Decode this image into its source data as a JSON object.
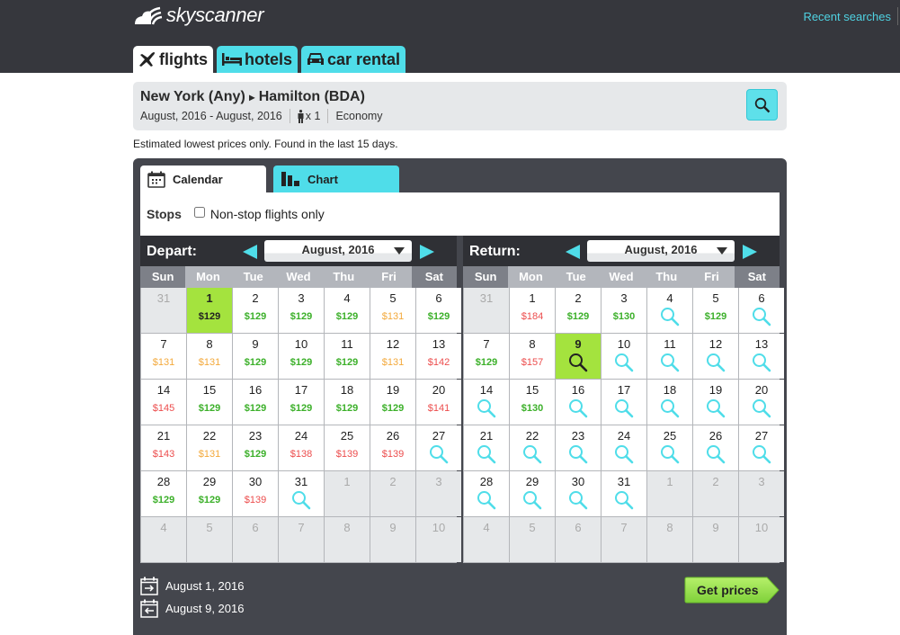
{
  "header": {
    "brand": "skyscanner",
    "recent_searches": "Recent searches"
  },
  "nav_tabs": [
    {
      "label": "flights",
      "icon": "plane-icon",
      "active": true
    },
    {
      "label": "hotels",
      "icon": "bed-icon",
      "active": false
    },
    {
      "label": "car rental",
      "icon": "car-icon",
      "active": false
    }
  ],
  "search": {
    "origin": "New York (Any)",
    "arrow": "▸",
    "destination": "Hamilton (BDA)",
    "dates": "August, 2016 - August, 2016",
    "passengers": "x 1",
    "cabin": "Economy"
  },
  "note": "Estimated lowest prices only. Found in the last 15 days.",
  "panel_tabs": [
    {
      "label": "Calendar",
      "icon": "calendar-icon",
      "active": true
    },
    {
      "label": "Chart",
      "icon": "bar-chart-icon",
      "active": false
    }
  ],
  "stops": {
    "label": "Stops",
    "option": "Non-stop flights only",
    "checked": false
  },
  "weekdays": [
    "Sun",
    "Mon",
    "Tue",
    "Wed",
    "Thu",
    "Fri",
    "Sat"
  ],
  "depart": {
    "title": "Depart:",
    "month": "August, 2016",
    "cells": [
      {
        "d": "31",
        "other": true
      },
      {
        "d": "1",
        "p": "$129",
        "c": "g",
        "sel": true
      },
      {
        "d": "2",
        "p": "$129",
        "c": "g"
      },
      {
        "d": "3",
        "p": "$129",
        "c": "g"
      },
      {
        "d": "4",
        "p": "$129",
        "c": "g"
      },
      {
        "d": "5",
        "p": "$131",
        "c": "o"
      },
      {
        "d": "6",
        "p": "$129",
        "c": "g"
      },
      {
        "d": "7",
        "p": "$131",
        "c": "o"
      },
      {
        "d": "8",
        "p": "$131",
        "c": "o"
      },
      {
        "d": "9",
        "p": "$129",
        "c": "g"
      },
      {
        "d": "10",
        "p": "$129",
        "c": "g"
      },
      {
        "d": "11",
        "p": "$129",
        "c": "g"
      },
      {
        "d": "12",
        "p": "$131",
        "c": "o"
      },
      {
        "d": "13",
        "p": "$142",
        "c": "r"
      },
      {
        "d": "14",
        "p": "$145",
        "c": "r"
      },
      {
        "d": "15",
        "p": "$129",
        "c": "g"
      },
      {
        "d": "16",
        "p": "$129",
        "c": "g"
      },
      {
        "d": "17",
        "p": "$129",
        "c": "g"
      },
      {
        "d": "18",
        "p": "$129",
        "c": "g"
      },
      {
        "d": "19",
        "p": "$129",
        "c": "g"
      },
      {
        "d": "20",
        "p": "$141",
        "c": "r"
      },
      {
        "d": "21",
        "p": "$143",
        "c": "r"
      },
      {
        "d": "22",
        "p": "$131",
        "c": "o"
      },
      {
        "d": "23",
        "p": "$129",
        "c": "g"
      },
      {
        "d": "24",
        "p": "$138",
        "c": "r"
      },
      {
        "d": "25",
        "p": "$139",
        "c": "r"
      },
      {
        "d": "26",
        "p": "$139",
        "c": "r"
      },
      {
        "d": "27",
        "search": true
      },
      {
        "d": "28",
        "p": "$129",
        "c": "g"
      },
      {
        "d": "29",
        "p": "$129",
        "c": "g"
      },
      {
        "d": "30",
        "p": "$139",
        "c": "r"
      },
      {
        "d": "31",
        "search": true
      },
      {
        "d": "1",
        "other": true
      },
      {
        "d": "2",
        "other": true
      },
      {
        "d": "3",
        "other": true
      },
      {
        "d": "4",
        "other": true
      },
      {
        "d": "5",
        "other": true
      },
      {
        "d": "6",
        "other": true
      },
      {
        "d": "7",
        "other": true
      },
      {
        "d": "8",
        "other": true
      },
      {
        "d": "9",
        "other": true
      },
      {
        "d": "10",
        "other": true
      }
    ]
  },
  "return": {
    "title": "Return:",
    "month": "August, 2016",
    "cells": [
      {
        "d": "31",
        "other": true
      },
      {
        "d": "1",
        "p": "$184",
        "c": "r"
      },
      {
        "d": "2",
        "p": "$129",
        "c": "g"
      },
      {
        "d": "3",
        "p": "$130",
        "c": "g"
      },
      {
        "d": "4",
        "search": true
      },
      {
        "d": "5",
        "p": "$129",
        "c": "g"
      },
      {
        "d": "6",
        "search": true
      },
      {
        "d": "7",
        "p": "$129",
        "c": "g"
      },
      {
        "d": "8",
        "p": "$157",
        "c": "r"
      },
      {
        "d": "9",
        "search": true,
        "sel": true
      },
      {
        "d": "10",
        "search": true
      },
      {
        "d": "11",
        "search": true
      },
      {
        "d": "12",
        "search": true
      },
      {
        "d": "13",
        "search": true
      },
      {
        "d": "14",
        "search": true
      },
      {
        "d": "15",
        "p": "$130",
        "c": "g"
      },
      {
        "d": "16",
        "search": true
      },
      {
        "d": "17",
        "search": true
      },
      {
        "d": "18",
        "search": true
      },
      {
        "d": "19",
        "search": true
      },
      {
        "d": "20",
        "search": true
      },
      {
        "d": "21",
        "search": true
      },
      {
        "d": "22",
        "search": true
      },
      {
        "d": "23",
        "search": true
      },
      {
        "d": "24",
        "search": true
      },
      {
        "d": "25",
        "search": true
      },
      {
        "d": "26",
        "search": true
      },
      {
        "d": "27",
        "search": true
      },
      {
        "d": "28",
        "search": true
      },
      {
        "d": "29",
        "search": true
      },
      {
        "d": "30",
        "search": true
      },
      {
        "d": "31",
        "search": true
      },
      {
        "d": "1",
        "other": true
      },
      {
        "d": "2",
        "other": true
      },
      {
        "d": "3",
        "other": true
      },
      {
        "d": "4",
        "other": true
      },
      {
        "d": "5",
        "other": true
      },
      {
        "d": "6",
        "other": true
      },
      {
        "d": "7",
        "other": true
      },
      {
        "d": "8",
        "other": true
      },
      {
        "d": "9",
        "other": true
      },
      {
        "d": "10",
        "other": true
      }
    ]
  },
  "selection": {
    "depart_date": "August 1, 2016",
    "return_date": "August 9, 2016"
  },
  "get_prices": "Get prices",
  "colors": {
    "accent": "#4fdde9",
    "selected": "#a4e33e",
    "price_low": "#3cb02a",
    "price_mid": "#f3a93b",
    "price_high": "#ec4d4d"
  }
}
